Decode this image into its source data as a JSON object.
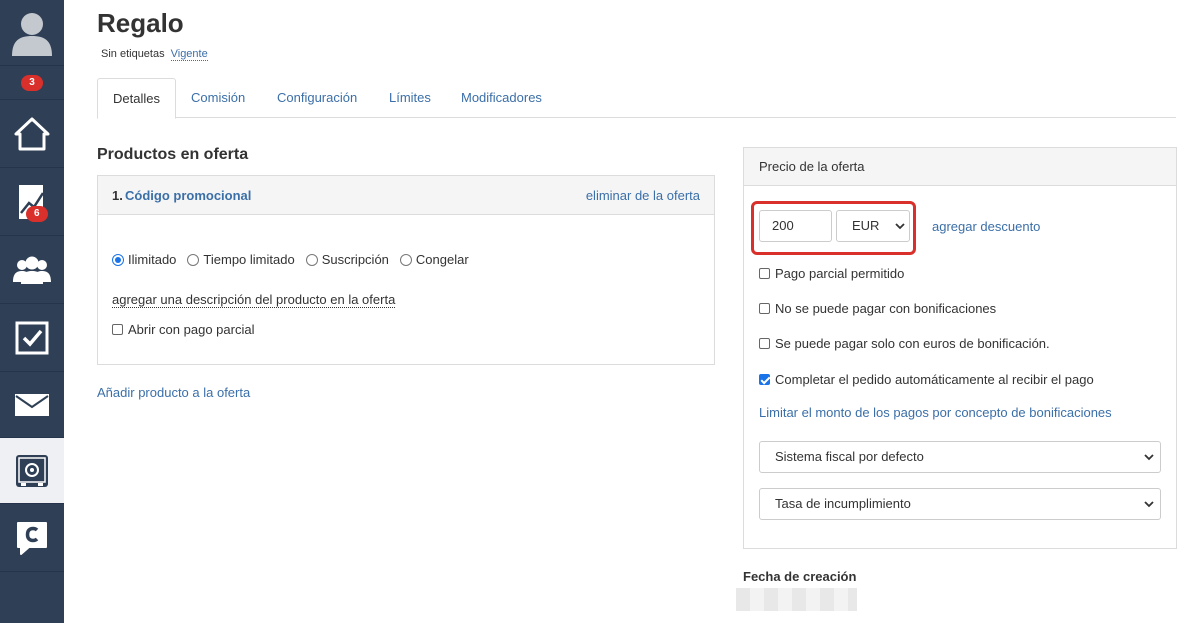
{
  "sidebar": {
    "items": [
      {
        "name": "user-avatar-icon"
      },
      {
        "name": "notifications",
        "badge": "3"
      },
      {
        "name": "home-icon"
      },
      {
        "name": "stats-icon",
        "badge": "6"
      },
      {
        "name": "users-icon"
      },
      {
        "name": "tasks-icon"
      },
      {
        "name": "mail-icon"
      },
      {
        "name": "safe-icon"
      },
      {
        "name": "chat-icon"
      }
    ]
  },
  "header": {
    "title": "Regalo",
    "tags": "Sin etiquetas",
    "status": "Vigente"
  },
  "tabs": [
    "Detalles",
    "Comisión",
    "Configuración",
    "Límites",
    "Modificadores"
  ],
  "products": {
    "section_title": "Productos en oferta",
    "item_number": "1.",
    "item_name": "Código promocional",
    "remove_label": "eliminar de la oferta",
    "duration_options": [
      {
        "label": "Ilimitado",
        "selected": true
      },
      {
        "label": "Tiempo limitado",
        "selected": false
      },
      {
        "label": "Suscripción",
        "selected": false
      },
      {
        "label": "Congelar",
        "selected": false
      }
    ],
    "add_description": "agregar una descripción del producto en la oferta",
    "partial_payment_open": "Abrir con pago parcial",
    "add_product": "Añadir producto a la oferta"
  },
  "price": {
    "panel_title": "Precio de la oferta",
    "amount": "200",
    "currency": "EUR",
    "add_discount": "agregar descuento",
    "options": [
      {
        "label": "Pago parcial permitido",
        "checked": false
      },
      {
        "label": "No se puede pagar con bonificaciones",
        "checked": false
      },
      {
        "label": "Se puede pagar solo con euros de bonificación.",
        "checked": false
      },
      {
        "label": "Completar el pedido automáticamente al recibir el pago",
        "checked": true
      }
    ],
    "limit_link": "Limitar el monto de los pagos por concepto de bonificaciones",
    "tax_system": "Sistema fiscal por defecto",
    "default_rate": "Tasa de incumplimiento"
  },
  "creation": {
    "title": "Fecha de creación"
  },
  "colors": {
    "sidebar": "#2f3f55",
    "link": "#3b6fa8",
    "badge": "#d9302c",
    "checkbox_on": "#1a73e8"
  }
}
